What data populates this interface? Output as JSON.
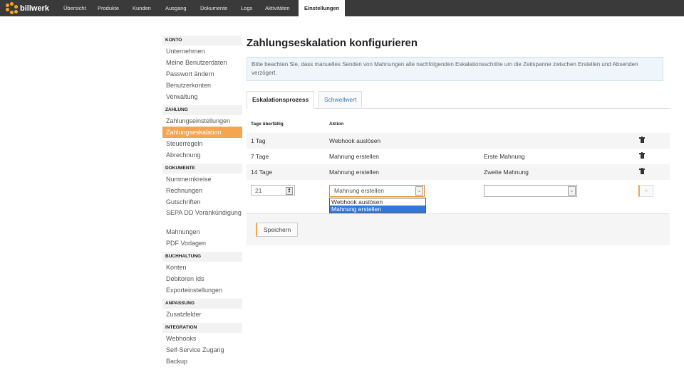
{
  "brand": {
    "name": "billwerk"
  },
  "nav": {
    "items": [
      "Übersicht",
      "Produkte",
      "Kunden",
      "Ausgang",
      "Dokumente",
      "Logs",
      "Aktivitäten"
    ],
    "active": "Einstellungen"
  },
  "sidebar": {
    "konto": {
      "title": "KONTO",
      "items": [
        "Unternehmen",
        "Meine Benutzerdaten",
        "Passwort ändern",
        "Benutzerkonten",
        "Verwaltung"
      ]
    },
    "zahlung": {
      "title": "ZAHLUNG",
      "items": [
        "Zahlungseinstellungen",
        "Zahlungseskalation",
        "Steuerregeln",
        "Abrechnung"
      ],
      "active": "Zahlungseskalation"
    },
    "dokumente": {
      "title": "DOKUMENTE",
      "items": [
        "Nummernkreise",
        "Rechnungen",
        "Gutschriften",
        "SEPA DD Vorankündigung",
        "Mahnungen",
        "PDF Vorlagen"
      ]
    },
    "buchhaltung": {
      "title": "BUCHHALTUNG",
      "items": [
        "Konten",
        "Debitoren Ids",
        "Exporteinstellungen"
      ]
    },
    "anpassung": {
      "title": "ANPASSUNG",
      "items": [
        "Zusatzfelder"
      ]
    },
    "integration": {
      "title": "INTEGRATION",
      "items": [
        "Webhooks",
        "Self-Service Zugang",
        "Backup"
      ]
    }
  },
  "main": {
    "title": "Zahlungseskalation konfigurieren",
    "notice": "Bitte beachten Sie, dass manuelles Senden von Mahnungen alle nachfolgenden Eskalationsschritte um die Zeitspanne zwischen Erstellen und Absenden verzögert.",
    "tabs": [
      {
        "label": "Eskalationsprozess",
        "active": true
      },
      {
        "label": "Schwellwert",
        "active": false
      }
    ],
    "columns": {
      "days": "Tage überfällig",
      "action": "Aktion"
    },
    "rows": [
      {
        "days": "1 Tag",
        "action": "Webhook auslösen",
        "label": ""
      },
      {
        "days": "7 Tage",
        "action": "Mahnung erstellen",
        "label": "Erste Mahnung"
      },
      {
        "days": "14 Tage",
        "action": "Mahnung erstellen",
        "label": "Zweite Mahnung"
      }
    ],
    "new_row": {
      "days_value": "21",
      "action_selected": "Mahnung erstellen",
      "action_options": [
        "Webhook auslösen",
        "Mahnung erstellen"
      ],
      "template_selected": "",
      "add_label": "+"
    },
    "save_label": "Speichern"
  },
  "icons": {
    "trash": "trash-icon",
    "spinner": "spinner-icon",
    "chevron": "chevron-down-icon"
  },
  "colors": {
    "accent": "#f5a44f",
    "link": "#3a78b5",
    "topbar": "#3a3a3a"
  }
}
